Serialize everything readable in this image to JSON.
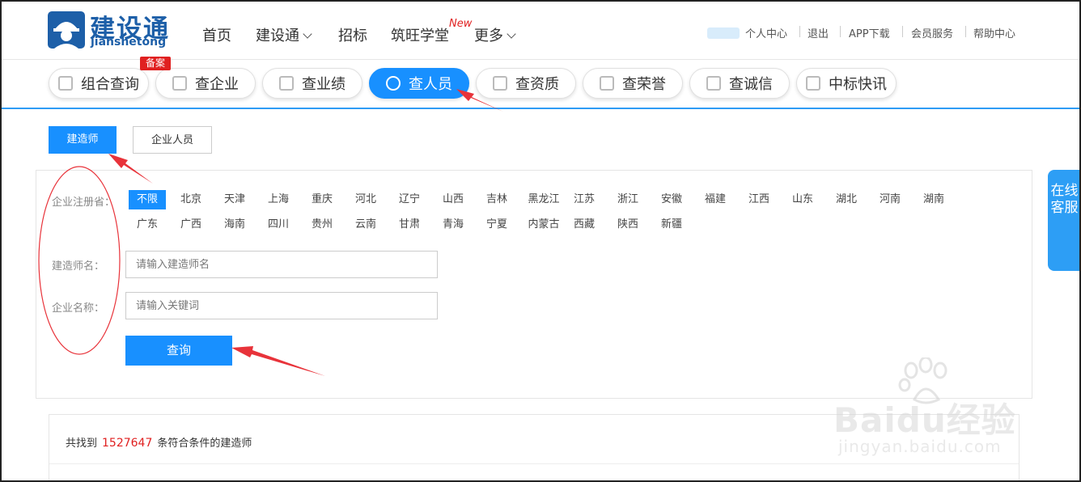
{
  "brand": {
    "name_cn": "建设通",
    "name_en": "jianshetong"
  },
  "nav": [
    {
      "label": "首页"
    },
    {
      "label": "建设通"
    },
    {
      "label": "招标"
    },
    {
      "label": "筑旺学堂"
    },
    {
      "label": "更多"
    }
  ],
  "nav_new_badge": "New",
  "top_links": [
    "个人中心",
    "退出",
    "APP下载",
    "会员服务",
    "帮助中心"
  ],
  "tabs": [
    {
      "label": "组合查询",
      "icon": "search-list-icon"
    },
    {
      "label": "查企业",
      "icon": "building-icon"
    },
    {
      "label": "查业绩",
      "icon": "chart-icon"
    },
    {
      "label": "查人员",
      "icon": "person-icon",
      "active": true
    },
    {
      "label": "查资质",
      "icon": "document-icon"
    },
    {
      "label": "查荣誉",
      "icon": "medal-icon"
    },
    {
      "label": "查诚信",
      "icon": "credit-icon"
    },
    {
      "label": "中标快讯",
      "icon": "news-icon"
    }
  ],
  "tab_badge": "备案",
  "subtabs": {
    "first": "建造师",
    "second": "企业人员"
  },
  "filters": {
    "province_label": "企业注册省：",
    "provinces": [
      "不限",
      "北京",
      "天津",
      "上海",
      "重庆",
      "河北",
      "辽宁",
      "山西",
      "吉林",
      "黑龙江",
      "江苏",
      "浙江",
      "安徽",
      "福建",
      "江西",
      "山东",
      "湖北",
      "河南",
      "湖南",
      "广东",
      "广西",
      "海南",
      "四川",
      "贵州",
      "云南",
      "甘肃",
      "青海",
      "宁夏",
      "内蒙古",
      "西藏",
      "陕西",
      "新疆"
    ],
    "selected_province": "不限",
    "name_label": "建造师名：",
    "name_placeholder": "请输入建造师名",
    "company_label": "企业名称：",
    "company_placeholder": "请输入关键词",
    "query_button": "查询"
  },
  "result": {
    "prefix": "共找到",
    "count": "1527647",
    "suffix": "条符合条件的建造师"
  },
  "service": {
    "label": "在线客服"
  },
  "watermark": {
    "line1": "Baidu经验",
    "line2": "jingyan.baidu.com"
  },
  "colors": {
    "accent": "#1890ff",
    "highlight": "#e02020",
    "brand": "#1d5fa8",
    "annotation": "#e8333a"
  }
}
